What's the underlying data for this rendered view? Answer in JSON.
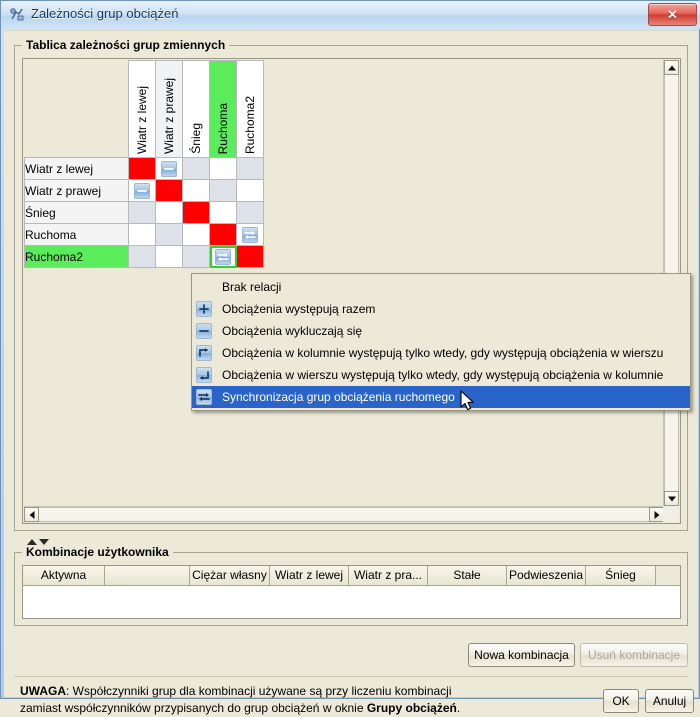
{
  "window": {
    "title": "Zależności grup obciążeń",
    "close_label": "✕"
  },
  "matrix_group": {
    "title": "Tablica zależności grup zmiennych",
    "columns": [
      "Wiatr z lewej",
      "Wiatr z prawej",
      "Śnieg",
      "Ruchoma",
      "Ruchoma2"
    ],
    "rows": [
      "Wiatr z lewej",
      "Wiatr z prawej",
      "Śnieg",
      "Ruchoma",
      "Ruchoma2"
    ],
    "selected_column": "Ruchoma",
    "selected_row": "Ruchoma2",
    "cells": [
      [
        "diag",
        "exclude",
        "",
        "",
        ""
      ],
      [
        "exclude",
        "diag",
        "",
        "",
        ""
      ],
      [
        "",
        "",
        "diag",
        "",
        ""
      ],
      [
        "",
        "",
        "",
        "diag",
        "sync"
      ],
      [
        "",
        "",
        "",
        "sync-selected",
        "diag"
      ]
    ],
    "colors": {
      "diagonal": "#fe0000",
      "cell": "#dde2e8",
      "cell_alt": "#ffffff",
      "selection": "#5bec5b",
      "selection_border": "#2fd02f"
    }
  },
  "context_menu": {
    "items": [
      {
        "label": "Brak relacji",
        "icon": "none",
        "highlighted": false
      },
      {
        "label": "Obciążenia występują razem",
        "icon": "plus-icon",
        "highlighted": false
      },
      {
        "label": "Obciążenia wykluczają się",
        "icon": "minus-icon",
        "highlighted": false
      },
      {
        "label": "Obciążenia w kolumnie występują tylko wtedy, gdy występują obciążenia w wierszu",
        "icon": "arrow-up-right-icon",
        "highlighted": false
      },
      {
        "label": "Obciążenia w wierszu występują tylko wtedy, gdy występują obciążenia w kolumnie",
        "icon": "arrow-down-left-icon",
        "highlighted": false
      },
      {
        "label": "Synchronizacja grup obciążenia ruchomego",
        "icon": "sync-arrows-icon",
        "highlighted": true
      }
    ],
    "highlight_color": "#2a64c8"
  },
  "combination_group": {
    "title": "Kombinacje użytkownika",
    "headers": [
      "Aktywna",
      "",
      "Ciężar własny",
      "Wiatr z lewej",
      "Wiatr z pra...",
      "Stałe",
      "Podwieszenia",
      "Śnieg"
    ],
    "rows": []
  },
  "buttons": {
    "new_combination": "Nowa kombinacja",
    "delete_combination": "Usuń kombinacje",
    "delete_combination_enabled": false,
    "ok": "OK",
    "cancel": "Anuluj"
  },
  "footer_note": {
    "prefix_bold": "UWAGA",
    "line1_rest": ": Współczynniki grup dla kombinacji używane są przy liczeniu kombinacji",
    "line2_start": "zamiast współczynników przypisanych do grup obciążeń w oknie ",
    "line2_bold": "Grupy obciążeń",
    "line2_end": "."
  }
}
